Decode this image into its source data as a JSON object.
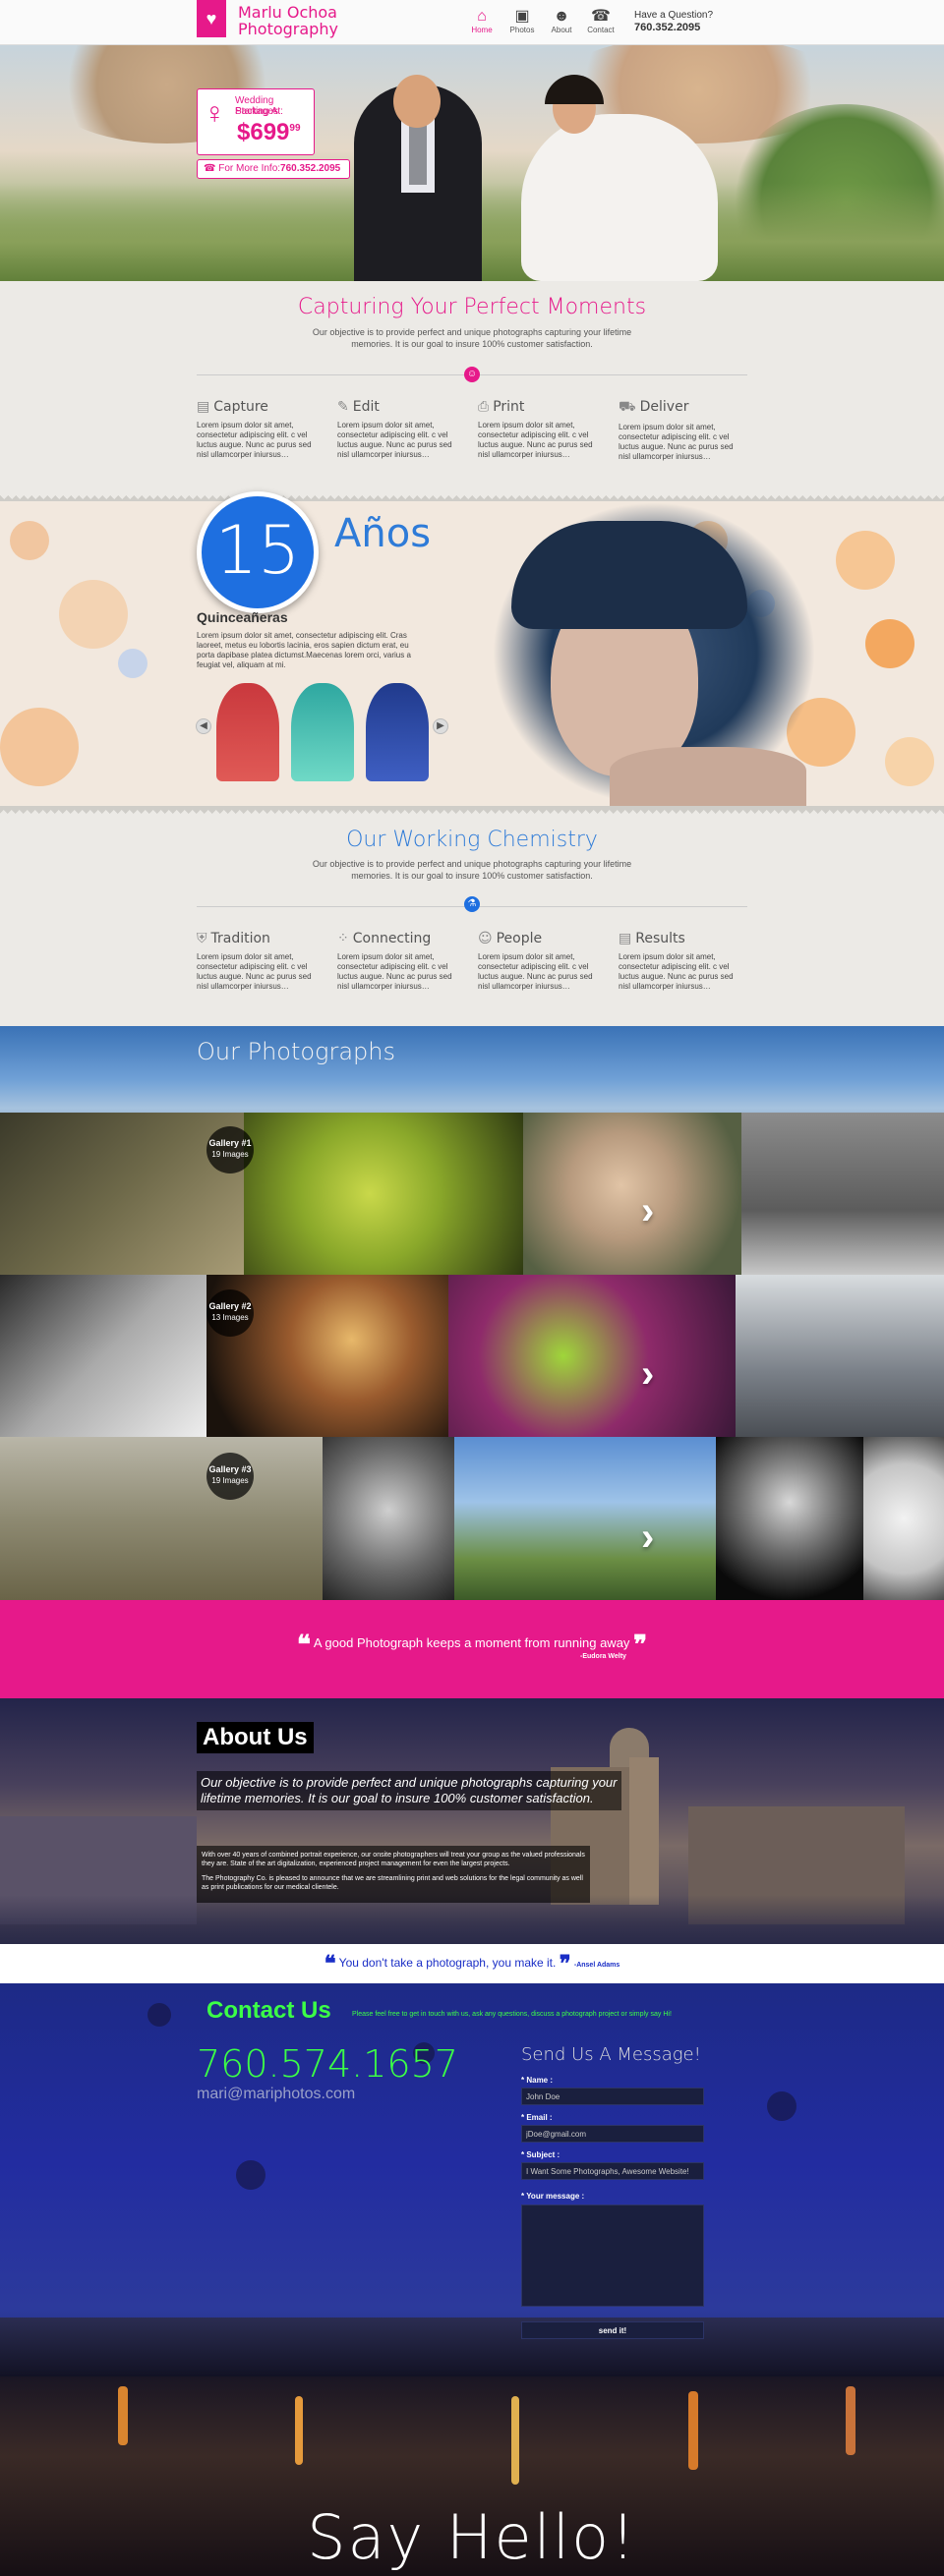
{
  "brand": {
    "line1": "Marlu Ochoa",
    "line2": "Photography",
    "logo_icon": "heart-icon"
  },
  "nav": [
    {
      "label": "Home",
      "icon": "home-icon",
      "active": true
    },
    {
      "label": "Photos",
      "icon": "photo-icon"
    },
    {
      "label": "About",
      "icon": "person-icon"
    },
    {
      "label": "Contact",
      "icon": "phone-icon"
    }
  ],
  "question": {
    "label": "Have a Question?",
    "phone": "760.352.2095"
  },
  "promo": {
    "line1": "Wedding Packages",
    "line2": "Starting At:",
    "price": "$699",
    "cents": "99",
    "more_label": "For More Info:",
    "more_phone": "760.352.2095"
  },
  "section1": {
    "title": "Capturing Your Perfect Moments",
    "sub1": "Our objective is to provide perfect and unique photographs capturing your lifetime",
    "sub2": "memories. It is our goal to insure 100% customer satisfaction."
  },
  "features1": [
    {
      "title": "Capture",
      "icon": "camera-icon",
      "text": "Lorem ipsum dolor sit amet, consectetur adipiscing elit. c vel luctus augue. Nunc ac purus sed nisl ullamcorper iniursus…"
    },
    {
      "title": "Edit",
      "icon": "pencil-icon",
      "text": "Lorem ipsum dolor sit amet, consectetur adipiscing elit. c vel luctus augue. Nunc ac purus sed nisl ullamcorper iniursus…"
    },
    {
      "title": "Print",
      "icon": "printer-icon",
      "text": "Lorem ipsum dolor sit amet, consectetur adipiscing elit. c vel luctus augue. Nunc ac purus sed nisl ullamcorper iniursus…"
    },
    {
      "title": "Deliver",
      "icon": "truck-icon",
      "text": "Lorem ipsum dolor sit amet, consectetur adipiscing elit. c vel luctus augue. Nunc ac purus sed nisl ullamcorper iniursus…"
    }
  ],
  "quince": {
    "number": "15",
    "anos": "Años",
    "title": "Quinceañeras",
    "text": "Lorem ipsum dolor sit amet, consectetur adipiscing elit. Cras laoreet, metus eu lobortis lacinia, eros sapien dictum erat, eu porta dapibase platea dictumst.Maecenas lorem orci, varius a feugiat vel, aliquam at mi."
  },
  "section2": {
    "title": "Our Working Chemistry",
    "sub1": "Our objective is to provide perfect and unique photographs capturing your lifetime",
    "sub2": "memories. It is our goal to insure 100% customer satisfaction."
  },
  "features2": [
    {
      "title": "Tradition",
      "icon": "shield-icon",
      "text": "Lorem ipsum dolor sit amet, consectetur adipiscing elit. c vel luctus augue. Nunc ac purus sed nisl ullamcorper iniursus…"
    },
    {
      "title": "Connecting",
      "icon": "dots-icon",
      "text": "Lorem ipsum dolor sit amet, consectetur adipiscing elit. c vel luctus augue. Nunc ac purus sed nisl ullamcorper iniursus…"
    },
    {
      "title": "People",
      "icon": "smiley-icon",
      "text": "Lorem ipsum dolor sit amet, consectetur adipiscing elit. c vel luctus augue. Nunc ac purus sed nisl ullamcorper iniursus…"
    },
    {
      "title": "Results",
      "icon": "document-icon",
      "text": "Lorem ipsum dolor sit amet, consectetur adipiscing elit. c vel luctus augue. Nunc ac purus sed nisl ullamcorper iniursus…"
    }
  ],
  "photos": {
    "title": "Our Photographs",
    "galleries": [
      {
        "name": "Gallery #1",
        "count": "19 Images"
      },
      {
        "name": "Gallery #2",
        "count": "13 Images"
      },
      {
        "name": "Gallery #3",
        "count": "19 Images"
      }
    ]
  },
  "quote1": {
    "text": "A good Photograph keeps a moment from running away",
    "author": "-Eudora Welty"
  },
  "about": {
    "title": "About Us",
    "lead": "Our objective is to provide perfect and unique photographs capturing your lifetime memories. It is our goal to insure 100% customer satisfaction.",
    "p1": "With over 40 years of combined portrait experience, our onsite photographers will treat your group as the valued professionals they are. State of the art digitalization, experienced project management for even the largest projects.",
    "p2": "The Photography Co. is pleased to announce that we are streamlining print and web solutions for the legal community as well as print publications for our medical clientele."
  },
  "quote2": {
    "text": "You don't take a photograph, you make it.",
    "author": "-Ansel Adams"
  },
  "contact": {
    "title": "Contact Us",
    "sub": "Please feel free to get in touch with us, ask any questions, discuss a photograph project or simply say Hi!",
    "phone": "760.574.1657",
    "email": "mari@mariphotos.com",
    "form_title": "Send Us A Message!",
    "name_label": "* Name :",
    "name_value": "John Doe",
    "email_label": "* Email :",
    "email_value": "jDoe@gmail.com",
    "subject_label": "* Subject :",
    "subject_value": "I Want Some Photographs, Awesome Website!",
    "message_label": "* Your message :",
    "send_label": "send it!",
    "hello": "Say Hello!"
  },
  "colors": {
    "pink": "#e6198a",
    "blue": "#1e6fe0",
    "green": "#3cff46",
    "quote_blue": "#1a2ec6"
  }
}
